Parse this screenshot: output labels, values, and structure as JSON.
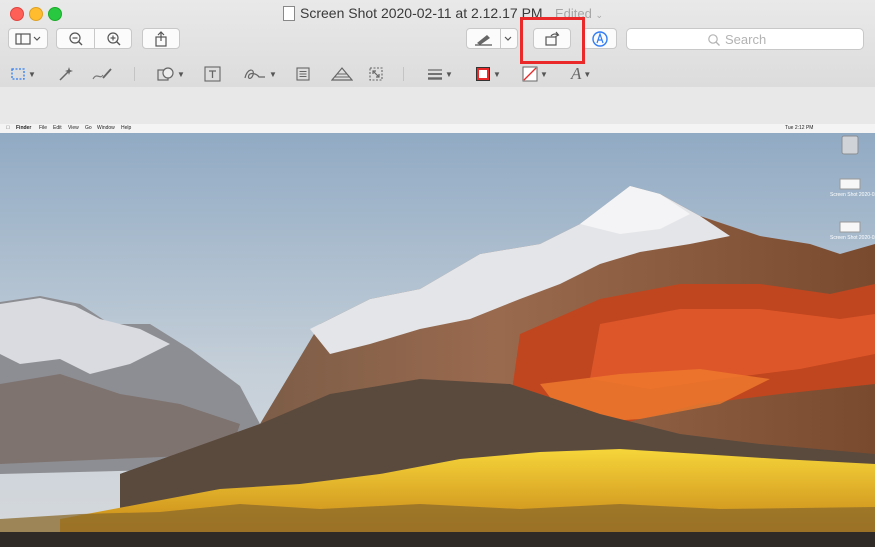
{
  "window": {
    "title": "Screen Shot 2020-02-11 at 2.12.17 PM",
    "edited_label": "Edited"
  },
  "toolbar": {
    "search_placeholder": "Search"
  },
  "screenshot_menubar": {
    "items": [
      "Finder",
      "File",
      "Edit",
      "View",
      "Go",
      "Window",
      "Help"
    ],
    "clock": "Tue 2:12 PM"
  },
  "desktop_icons": [
    {
      "label": "Screen Shot\n2020-02...12.17 PM"
    },
    {
      "label": "Screen Shot\n2020-02...12.17 PM"
    }
  ],
  "colors": {
    "highlight": "#ea2a2a",
    "accent_blue": "#2f7cf6"
  }
}
